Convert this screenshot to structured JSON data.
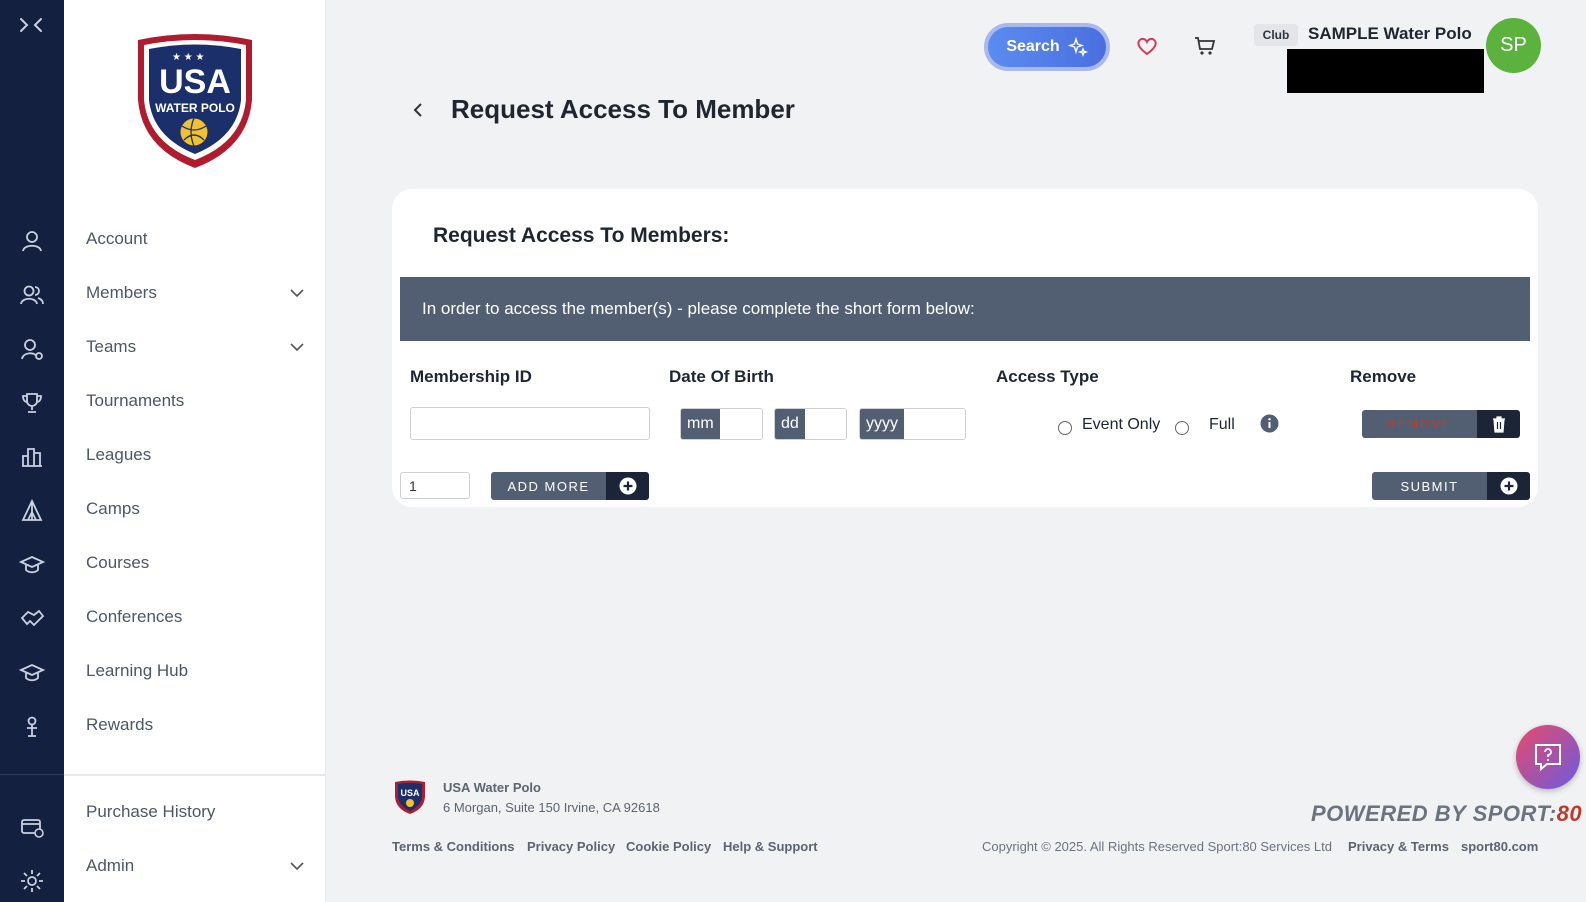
{
  "header": {
    "search_label": "Search",
    "club_badge": "Club",
    "club_name": "SAMPLE Water Polo",
    "avatar_initials": "SP"
  },
  "sidebar": {
    "items": [
      {
        "label": "Account",
        "icon": "user-icon"
      },
      {
        "label": "Members",
        "icon": "users-icon",
        "expandable": true
      },
      {
        "label": "Teams",
        "icon": "team-icon",
        "expandable": true
      },
      {
        "label": "Tournaments",
        "icon": "trophy-icon"
      },
      {
        "label": "Leagues",
        "icon": "bar-chart-icon"
      },
      {
        "label": "Camps",
        "icon": "tent-icon"
      },
      {
        "label": "Courses",
        "icon": "graduation-cap-icon"
      },
      {
        "label": "Conferences",
        "icon": "handshake-icon"
      },
      {
        "label": "Learning Hub",
        "icon": "graduation-cap-icon"
      },
      {
        "label": "Rewards",
        "icon": "reward-icon"
      }
    ],
    "bottom_items": [
      {
        "label": "Purchase History",
        "icon": "card-history-icon"
      },
      {
        "label": "Admin",
        "icon": "gear-icon",
        "expandable": true
      }
    ]
  },
  "page": {
    "title": "Request Access To Member",
    "card_title": "Request Access To Members:",
    "banner_text": "In order to access the member(s) - please complete the short form below:",
    "columns": {
      "membership_id": "Membership ID",
      "dob": "Date Of Birth",
      "access_type": "Access Type",
      "remove": "Remove"
    },
    "dob_prefixes": {
      "month": "mm",
      "day": "dd",
      "year": "yyyy"
    },
    "access_options": {
      "event_only": "Event Only",
      "full": "Full"
    },
    "remove_label": "REMOVE",
    "count_value": "1",
    "add_more_label": "ADD MORE",
    "submit_label": "SUBMIT"
  },
  "footer": {
    "org_name": "USA Water Polo",
    "address": "6 Morgan, Suite 150 Irvine, CA 92618",
    "links": [
      "Terms & Conditions",
      "Privacy Policy",
      "Cookie Policy",
      "Help & Support"
    ],
    "powered_by": "POWERED BY SPORT:",
    "powered_num": "80",
    "copyright": "Copyright © 2025. All Rights Reserved Sport:80 Services Ltd",
    "privacy_terms": "Privacy & Terms",
    "site": "sport80.com"
  },
  "logo": {
    "line1": "USA",
    "line2": "WATER POLO"
  },
  "colors": {
    "rail": "#13203f",
    "banner": "#525f72",
    "avatar": "#5bb33e",
    "accent": "#4a6fe0"
  }
}
